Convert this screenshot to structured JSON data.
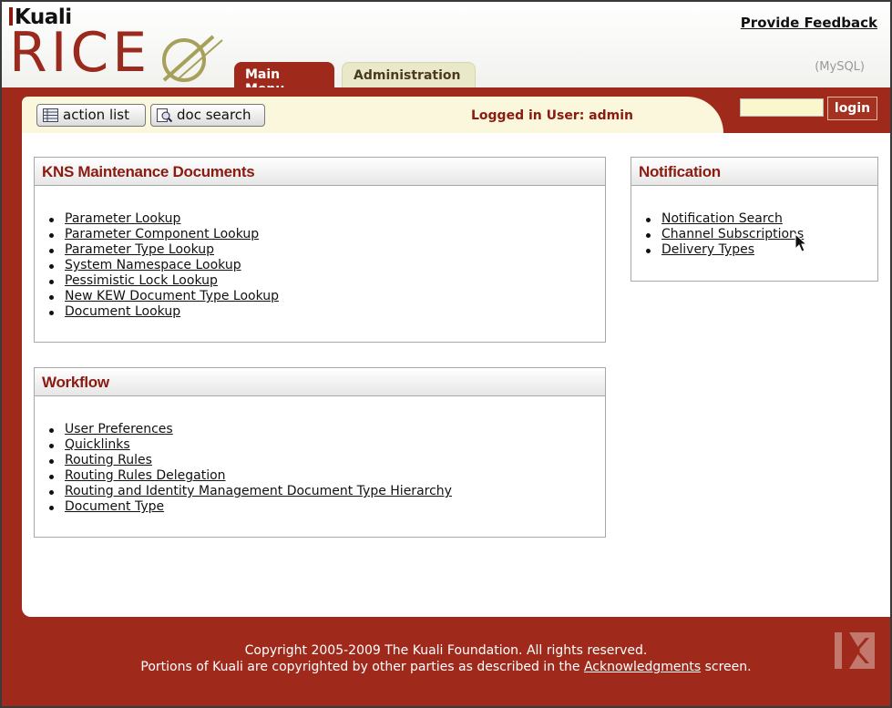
{
  "header": {
    "kuali_logo": "Kuali",
    "rice_logo": "RICE",
    "feedback_link": "Provide Feedback",
    "db_label": "(MySQL)",
    "tabs": [
      {
        "label": "Main Menu",
        "active": true
      },
      {
        "label": "Administration",
        "active": false
      }
    ]
  },
  "toolbar": {
    "action_list": "action list",
    "doc_search": "doc search",
    "logged_in": "Logged in User: admin",
    "login_input_value": "",
    "login_button": "login"
  },
  "sections": {
    "kns": {
      "title": "KNS Maintenance Documents",
      "items": [
        "Parameter Lookup",
        "Parameter Component Lookup",
        "Parameter Type Lookup",
        "System Namespace Lookup",
        "Pessimistic Lock Lookup",
        "New KEW Document Type Lookup",
        "Document Lookup"
      ]
    },
    "workflow": {
      "title": "Workflow",
      "items": [
        "User Preferences",
        "Quicklinks",
        "Routing Rules",
        "Routing Rules Delegation",
        "Routing and Identity Management Document Type Hierarchy",
        "Document Type"
      ]
    },
    "notification": {
      "title": "Notification",
      "items": [
        "Notification Search",
        "Channel Subscriptions",
        "Delivery Types"
      ]
    }
  },
  "footer": {
    "copyright": "Copyright 2005-2009 The Kuali Foundation. All rights reserved.",
    "portions_prefix": "Portions of Kuali are copyrighted by other parties as described in the ",
    "acknowledgments": "Acknowledgments",
    "portions_suffix": " screen."
  },
  "colors": {
    "brand_red": "#9f2a1c",
    "toolbar_cream": "#fbf7dc",
    "admin_tab": "#e9e8c8",
    "rice_mark_olive": "#a7a05a"
  },
  "icons": [
    "action-list-icon",
    "doc-search-icon",
    "rice-mark-icon",
    "mouse-cursor-icon",
    "kuali-k-footer-icon"
  ]
}
